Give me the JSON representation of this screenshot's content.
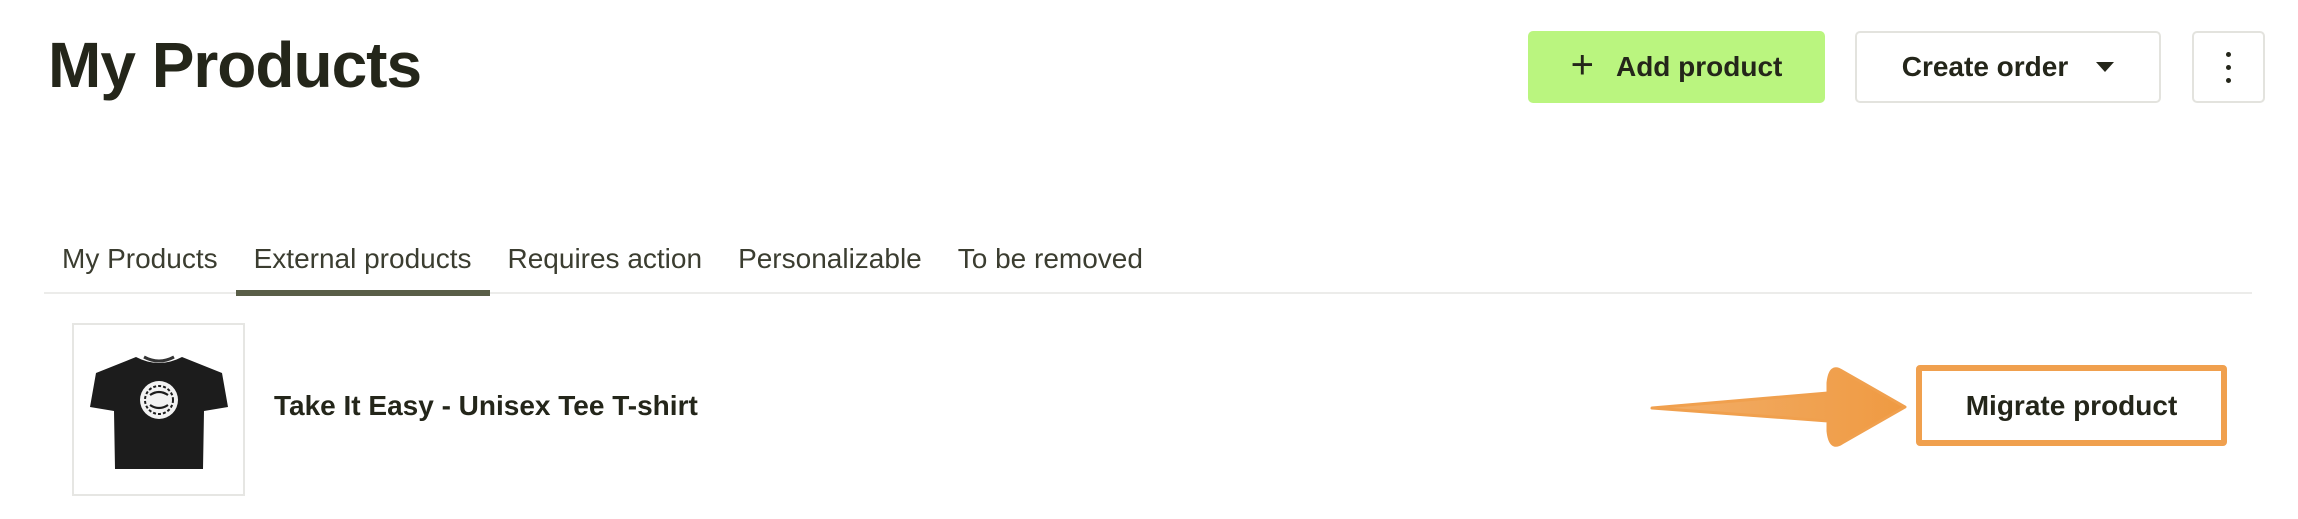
{
  "header": {
    "title": "My Products",
    "add_product_label": "Add product",
    "create_order_label": "Create order"
  },
  "tabs": [
    {
      "label": "My Products",
      "active": false
    },
    {
      "label": "External products",
      "active": true
    },
    {
      "label": "Requires action",
      "active": false
    },
    {
      "label": "Personalizable",
      "active": false
    },
    {
      "label": "To be removed",
      "active": false
    }
  ],
  "products": [
    {
      "name": "Take It Easy - Unisex Tee T-shirt",
      "action_label": "Migrate product",
      "thumbnail_icon": "tshirt-icon",
      "shirt_print": "TAKE IT EASY"
    }
  ],
  "colors": {
    "primary_button": "#baf57f",
    "annotation_orange": "#f0a04e",
    "active_tab_underline": "#595e47",
    "text": "#24261a"
  }
}
